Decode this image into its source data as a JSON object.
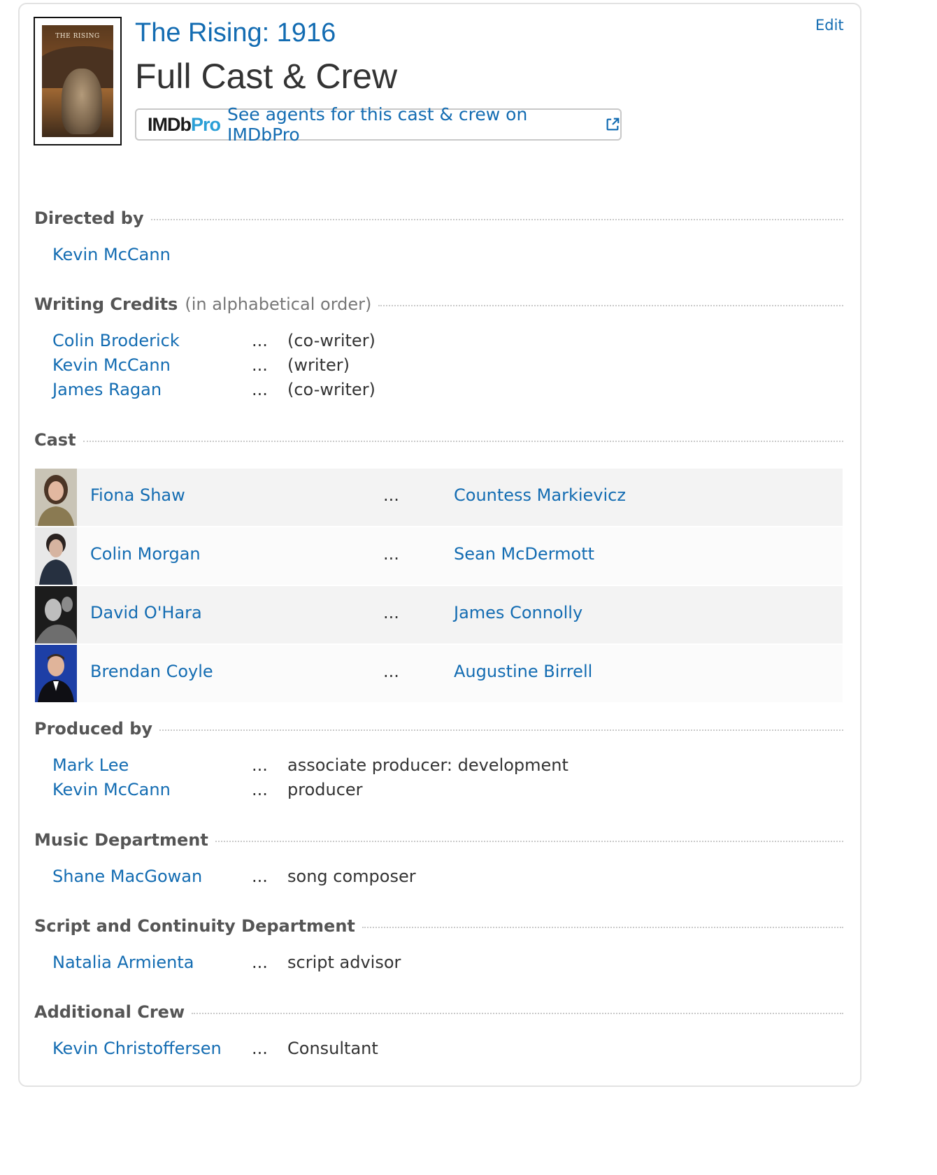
{
  "header": {
    "movie_title": "The Rising: 1916",
    "page_title": "Full Cast & Crew",
    "edit_label": "Edit",
    "poster_text": "THE RISING",
    "pro_logo_main": "IMDb",
    "pro_logo_pro": "Pro",
    "pro_link_text": "See agents for this cast & crew on IMDbPro"
  },
  "directed": {
    "heading": "Directed by",
    "items": [
      {
        "name": "Kevin McCann"
      }
    ]
  },
  "writing": {
    "heading": "Writing Credits",
    "subheading": "(in alphabetical order)",
    "items": [
      {
        "name": "Colin Broderick",
        "dots": "...",
        "role": "(co-writer)"
      },
      {
        "name": "Kevin McCann",
        "dots": "...",
        "role": "(writer)"
      },
      {
        "name": "James Ragan",
        "dots": "...",
        "role": "(co-writer)"
      }
    ]
  },
  "cast": {
    "heading": "Cast",
    "items": [
      {
        "actor": "Fiona Shaw",
        "dots": "...",
        "character": "Countess Markievicz"
      },
      {
        "actor": "Colin Morgan",
        "dots": "...",
        "character": "Sean McDermott"
      },
      {
        "actor": "David O'Hara",
        "dots": "...",
        "character": "James Connolly"
      },
      {
        "actor": "Brendan Coyle",
        "dots": "...",
        "character": "Augustine Birrell"
      }
    ]
  },
  "produced": {
    "heading": "Produced by",
    "items": [
      {
        "name": "Mark Lee",
        "dots": "...",
        "role": "associate producer: development"
      },
      {
        "name": "Kevin McCann",
        "dots": "...",
        "role": "producer"
      }
    ]
  },
  "music": {
    "heading": "Music Department",
    "items": [
      {
        "name": "Shane MacGowan",
        "dots": "...",
        "role": "song composer"
      }
    ]
  },
  "script": {
    "heading": "Script and Continuity Department",
    "items": [
      {
        "name": "Natalia Armienta",
        "dots": "...",
        "role": "script advisor"
      }
    ]
  },
  "additional": {
    "heading": "Additional Crew",
    "items": [
      {
        "name": "Kevin Christoffersen",
        "dots": "...",
        "role": "Consultant"
      }
    ]
  },
  "colors": {
    "link": "#136cb2",
    "text": "#333333",
    "heading": "#555555",
    "pro_accent": "#2a9fd6"
  }
}
